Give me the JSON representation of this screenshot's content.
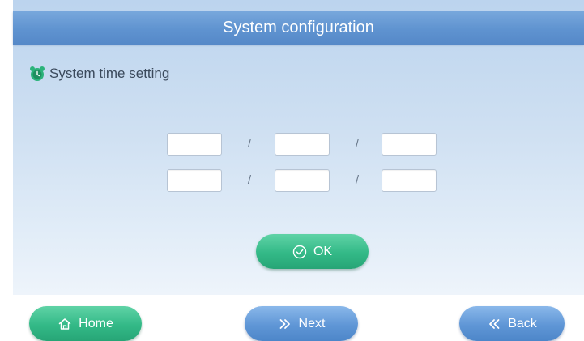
{
  "header": {
    "title": "System configuration"
  },
  "section": {
    "label": "System time setting",
    "icon": "alarm-clock-icon",
    "icon_color": "#2bb37a"
  },
  "time_fields": {
    "separator": "/",
    "row1": [
      "",
      "",
      ""
    ],
    "row2": [
      "",
      "",
      ""
    ]
  },
  "buttons": {
    "ok": {
      "label": "OK",
      "icon": "check-circle-icon"
    },
    "home": {
      "label": "Home",
      "icon": "home-icon"
    },
    "next": {
      "label": "Next",
      "icon": "double-chevron-right-icon"
    },
    "back": {
      "label": "Back",
      "icon": "double-chevron-left-icon"
    }
  },
  "colors": {
    "title_bar": "#5f93d0",
    "green_button": "#33b987",
    "blue_button": "#5f96d6",
    "panel_background": "#cfe0f2"
  }
}
